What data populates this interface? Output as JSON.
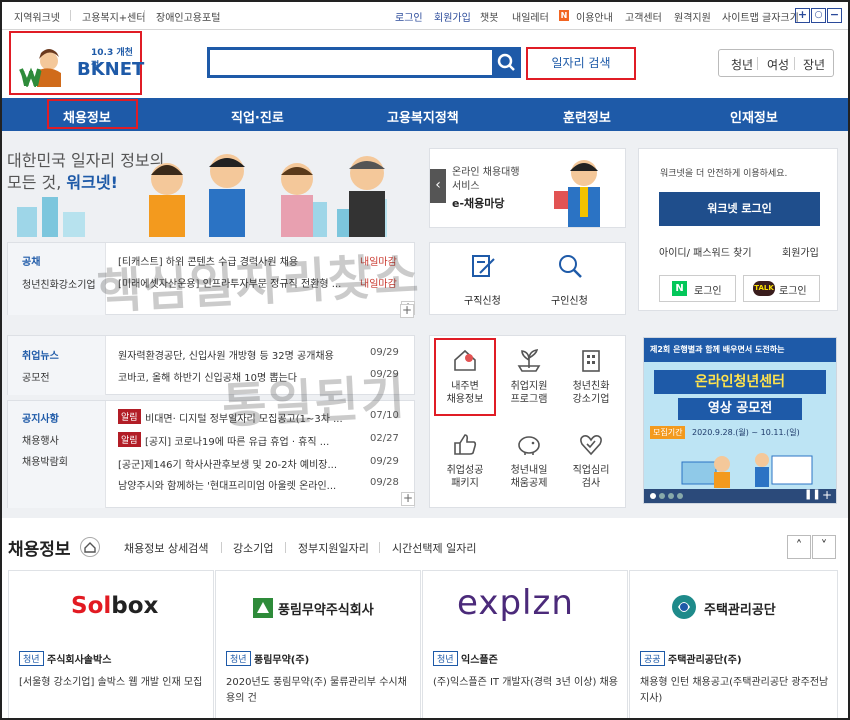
{
  "top_links_left": [
    "지역워크넷",
    "고용복지+센터",
    "장애인고용포털"
  ],
  "top_links_right": [
    "로그인",
    "회원가입",
    "챗봇",
    "내일레터",
    "이용안내",
    "고객센터",
    "원격지원",
    "사이트맵",
    "글자크기"
  ],
  "newbadge": "N",
  "zoom": {
    "plus": "+",
    "reset": "○",
    "minus": "−"
  },
  "logo": {
    "sub": "10.3 개천절",
    "text": "BKNET",
    "w": "W"
  },
  "search": {
    "placeholder": "",
    "button_label": "일자리 검색"
  },
  "segments": [
    "청년",
    "여성",
    "장년"
  ],
  "nav": [
    "채용정보",
    "직업·진로",
    "고용복지정책",
    "훈련정보",
    "인재정보"
  ],
  "hero": {
    "line1": "대한민국 일자리 정보의",
    "line2a": "모든 것, ",
    "line2b": "워크넷!"
  },
  "emadang": {
    "line1": "온라인 채용대행",
    "line2": "서비스",
    "title": "e-채용마당"
  },
  "login": {
    "notice": "워크넷을 더 안전하게 이용하세요.",
    "button": "워크넷 로그인",
    "find": "아이디/ 패스워드 찾기",
    "join": "회원가입",
    "naver": "로그인",
    "kakao": "로그인",
    "naver_n": "N",
    "kakao_talk": "TALK"
  },
  "job_tabs": {
    "tab1": "공채",
    "tab2": "청년친화강소기업"
  },
  "job_list": [
    {
      "text": "[티캐스트] 하위 콘텐츠 수급 경력사원 채용",
      "date": "내일마감"
    },
    {
      "text": "[미래에셋자산운용] 인프라투자부문 정규직 전환형 ...",
      "date": "내일마감"
    }
  ],
  "apply": [
    "구직신청",
    "구인신청"
  ],
  "news_tabs": [
    "취업뉴스",
    "공모전"
  ],
  "news": [
    {
      "text": "원자력환경공단, 신입사원 개방형 등 32명 공개채용",
      "date": "09/29"
    },
    {
      "text": "코바코, 올해 하반기 신입공채 10명 뽑는다",
      "date": "09/29"
    }
  ],
  "notice_tabs": [
    "공지사항",
    "채용행사",
    "채용박람회"
  ],
  "notices": [
    {
      "tag": "알림",
      "text": "비대면· 디지털 정부일자리 모집공고(1~3차 ...",
      "date": "07/10"
    },
    {
      "tag": "알림",
      "text": "[공지] 코로나19에 따른 유급 휴업 · 휴직 ...",
      "date": "02/27"
    },
    {
      "tag": "",
      "text": "[공군]제146기 학사사관후보생 및 20-2차 예비장...",
      "date": "09/29"
    },
    {
      "tag": "",
      "text": "남양주시와 함께하는 '현대프리미엄 아울렛 온라인...",
      "date": "09/28"
    }
  ],
  "quick": [
    {
      "l1": "내주변",
      "l2": "채용정보"
    },
    {
      "l1": "취업지원",
      "l2": "프로그램"
    },
    {
      "l1": "청년친화",
      "l2": "강소기업"
    },
    {
      "l1": "취업성공",
      "l2": "패키지"
    },
    {
      "l1": "청년내일",
      "l2": "채움공제"
    },
    {
      "l1": "직업심리",
      "l2": "검사"
    }
  ],
  "banner": {
    "top": "제2회 은행별과 함께 배우면서 도전하는",
    "l1": "온라인청년센터",
    "l2": "영상 공모전",
    "period_label": "모집기간",
    "period": "2020.9.28.(월) ~ 10.11.(일)"
  },
  "watermark": {
    "a": "핵심일자리찾소",
    "b": "통일된기"
  },
  "section": {
    "title": "채용정보",
    "links": [
      "채용정보 상세검색",
      "강소기업",
      "정부지원일자리",
      "시간선택제 일자리"
    ]
  },
  "companies": [
    {
      "logo": "Solbox",
      "tag": "청년",
      "name": "주식회사솔박스",
      "desc": "[서울형 강소기업] 솔박스 웹 개발 인재 모집"
    },
    {
      "logo": "풍림무약주식회사",
      "tag": "청년",
      "name": "풍림무약(주)",
      "desc": "2020년도 풍림무약(주) 물류관리부 수시채용의 건"
    },
    {
      "logo": "explzn",
      "tag": "청년",
      "name": "익스플즌",
      "desc": "(주)익스플즌 IT 개발자(경력 3년 이상) 채용"
    },
    {
      "logo": "주택관리공단",
      "tag": "공공",
      "name": "주택관리공단(주)",
      "desc": "채용형 인턴 채용공고(주택관리공단 광주전남지사)"
    }
  ],
  "colors": {
    "brand": "#1e5aa8",
    "highlight": "#e01c25",
    "tag": "#b21d26"
  }
}
